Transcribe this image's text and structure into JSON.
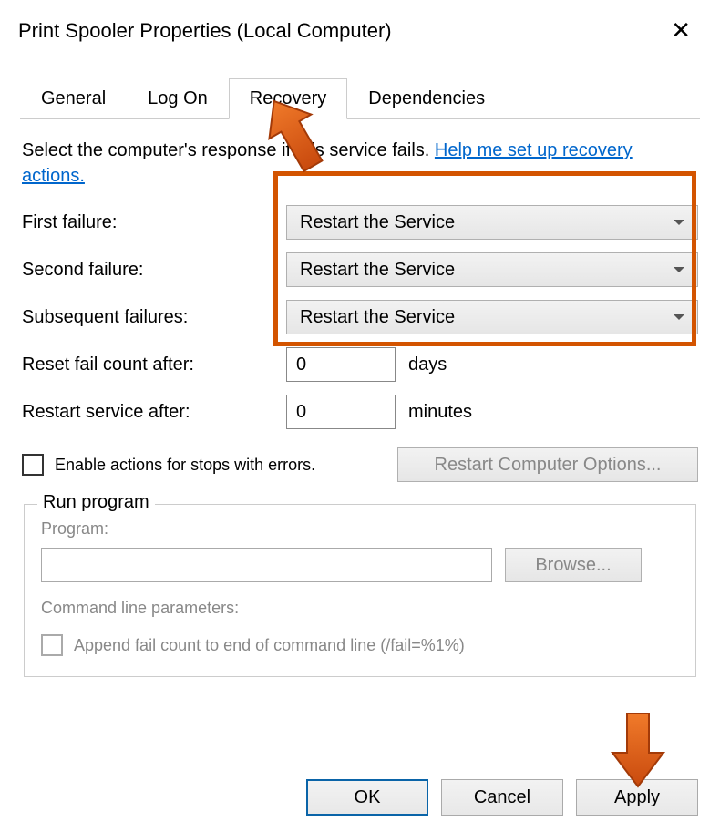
{
  "window": {
    "title": "Print Spooler Properties (Local Computer)"
  },
  "tabs": {
    "general": "General",
    "logon": "Log On",
    "recovery": "Recovery",
    "dependencies": "Dependencies"
  },
  "intro": {
    "text_before": "Select the computer's response if this service fails. ",
    "link": "Help me set up recovery actions."
  },
  "failures": {
    "first_label": "First failure:",
    "first_value": "Restart the Service",
    "second_label": "Second failure:",
    "second_value": "Restart the Service",
    "subsequent_label": "Subsequent failures:",
    "subsequent_value": "Restart the Service"
  },
  "reset": {
    "label": "Reset fail count after:",
    "value": "0",
    "unit": "days"
  },
  "restart": {
    "label": "Restart service after:",
    "value": "0",
    "unit": "minutes"
  },
  "enable_actions": {
    "label": "Enable actions for stops with errors."
  },
  "restart_computer_btn": "Restart Computer Options...",
  "run_program": {
    "legend": "Run program",
    "program_label": "Program:",
    "browse": "Browse...",
    "cmd_label": "Command line parameters:",
    "append_label": "Append fail count to end of command line (/fail=%1%)"
  },
  "buttons": {
    "ok": "OK",
    "cancel": "Cancel",
    "apply": "Apply"
  }
}
